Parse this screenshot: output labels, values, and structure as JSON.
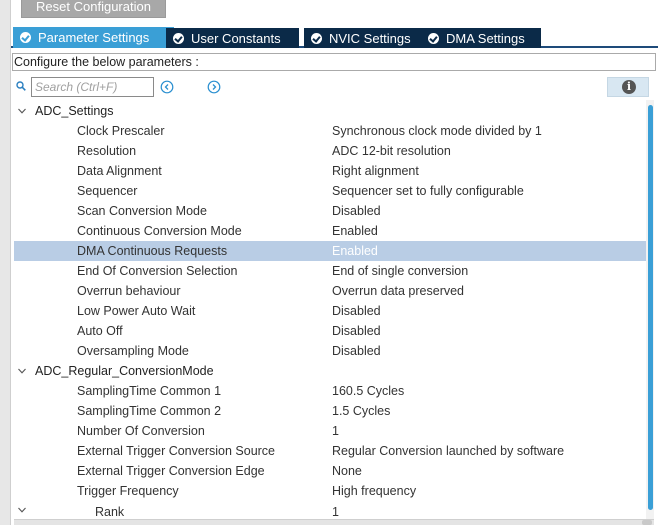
{
  "toolbar": {
    "reset_label": "Reset Configuration"
  },
  "tabs": [
    {
      "label": "Parameter Settings",
      "active": true
    },
    {
      "label": "User Constants",
      "active": false
    },
    {
      "label": "NVIC Settings",
      "active": false
    },
    {
      "label": "DMA Settings",
      "active": false
    }
  ],
  "config_label": "Configure the below parameters :",
  "search": {
    "placeholder": "Search (Ctrl+F)",
    "value": ""
  },
  "icons": {
    "search": "search-icon",
    "prev": "arrow-left-circle-icon",
    "next": "arrow-right-circle-icon",
    "info": "info-icon",
    "expand": "chevron-down-icon"
  },
  "colors": {
    "active_tab": "#3a9fd6",
    "inactive_tab": "#0b2a48",
    "selected_row": "#b9cde5",
    "scroll_thumb": "#3a9fd6"
  },
  "groups": [
    {
      "name": "ADC_Settings",
      "params": [
        {
          "name": "Clock Prescaler",
          "value": "Synchronous clock mode divided by 1"
        },
        {
          "name": "Resolution",
          "value": "ADC 12-bit resolution"
        },
        {
          "name": "Data Alignment",
          "value": "Right alignment"
        },
        {
          "name": "Sequencer",
          "value": "Sequencer set to fully configurable"
        },
        {
          "name": "Scan Conversion Mode",
          "value": "Disabled"
        },
        {
          "name": "Continuous Conversion Mode",
          "value": "Enabled"
        },
        {
          "name": "DMA Continuous Requests",
          "value": "Enabled",
          "selected": true
        },
        {
          "name": "End Of Conversion Selection",
          "value": "End of single conversion"
        },
        {
          "name": "Overrun behaviour",
          "value": "Overrun data preserved"
        },
        {
          "name": "Low Power Auto Wait",
          "value": "Disabled"
        },
        {
          "name": "Auto Off",
          "value": "Disabled"
        },
        {
          "name": "Oversampling Mode",
          "value": "Disabled"
        }
      ]
    },
    {
      "name": "ADC_Regular_ConversionMode",
      "params": [
        {
          "name": "SamplingTime Common 1",
          "value": "160.5 Cycles"
        },
        {
          "name": "SamplingTime Common 2",
          "value": "1.5 Cycles"
        },
        {
          "name": "Number Of Conversion",
          "value": "1"
        },
        {
          "name": "External Trigger Conversion Source",
          "value": "Regular Conversion launched by software"
        },
        {
          "name": "External Trigger Conversion Edge",
          "value": "None"
        },
        {
          "name": "Trigger Frequency",
          "value": "High frequency"
        }
      ]
    }
  ],
  "rank_row": {
    "name": "Rank",
    "value": "1"
  }
}
